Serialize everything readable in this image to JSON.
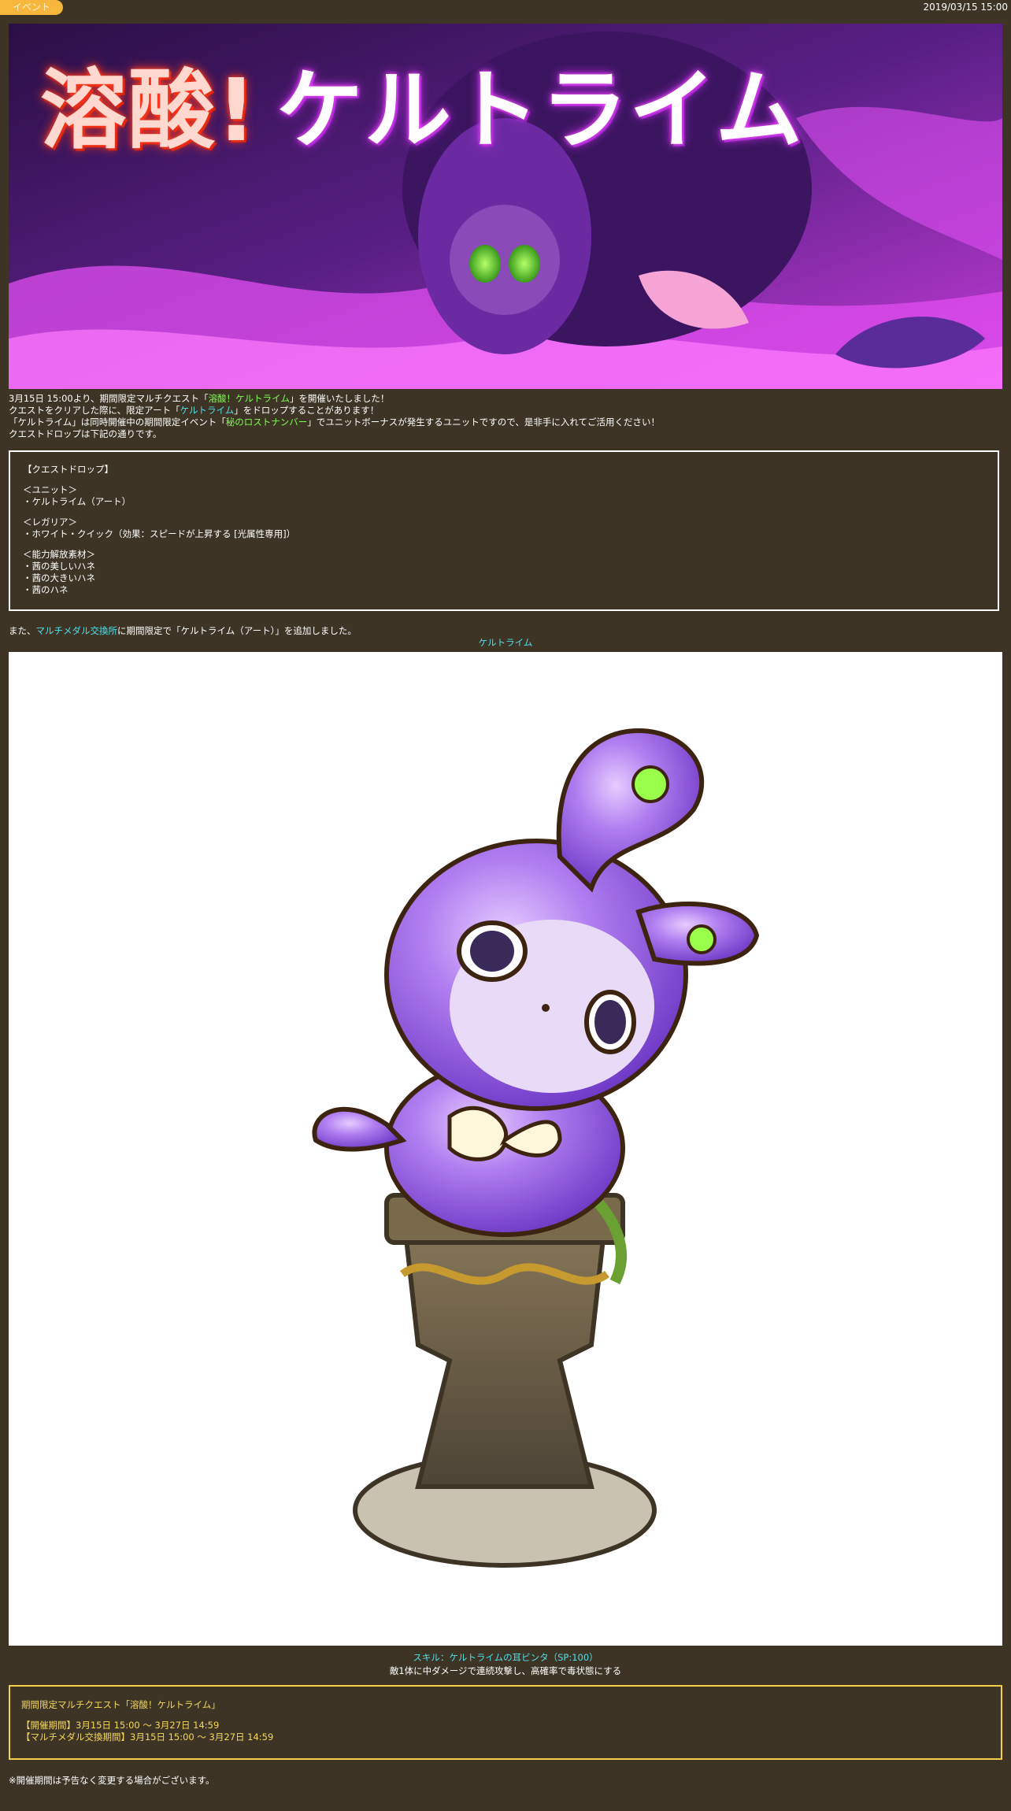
{
  "header": {
    "category_tag": "イベント",
    "date": "2019/03/15 15:00"
  },
  "banner": {
    "title_part1": "溶酸!",
    "title_part2": "ケルトライム"
  },
  "intro": {
    "line1_pre": "3月15日 15:00より、期間限定マルチクエスト「",
    "line1_link": "溶酸！ケルトライム",
    "line1_post": "」を開催いたしました！",
    "line2_pre": "クエストをクリアした際に、限定アート「",
    "line2_link": "ケルトライム",
    "line2_post": "」をドロップすることがあります！",
    "line3_pre": "「ケルトライム」は同時開催中の期間限定イベント「",
    "line3_link": "秘のロストナンバー",
    "line3_post": "」でユニットボーナスが発生するユニットですので、是非手に入れてご活用ください！",
    "line4": "クエストドロップは下記の通りです。"
  },
  "drops": {
    "heading": "【クエストドロップ】",
    "unit_label": "＜ユニット＞",
    "unit_item": "・ケルトライム（アート）",
    "regalia_label": "＜レガリア＞",
    "regalia_item": "・ホワイト・クイック（効果：スピードが上昇する [光属性専用]）",
    "material_label": "＜能力解放素材＞",
    "material_items": [
      "・茜の美しいハネ",
      "・茜の大きいハネ",
      "・茜のハネ"
    ]
  },
  "exchange": {
    "pre": "また、",
    "link": "マルチメダル交換所",
    "post": "に期間限定で「ケルトライム（アート）」を追加しました。"
  },
  "art": {
    "caption": "ケルトライム"
  },
  "skill": {
    "name": "スキル：ケルトライムの耳ビンタ（SP:100）",
    "description": "敵1体に中ダメージで連続攻撃し、高確率で毒状態にする"
  },
  "period": {
    "title": "期間限定マルチクエスト「溶酸！ケルトライム」",
    "event_period": "【開催期間】3月15日 15:00 ～ 3月27日 14:59",
    "exchange_period": "【マルチメダル交換期間】3月15日 15:00 ～ 3月27日 14:59"
  },
  "footer": {
    "note": "※開催期間は予告なく変更する場合がございます。"
  },
  "colors": {
    "background": "#3d3426",
    "tag": "#f6b73c",
    "link_green": "#7dff4f",
    "link_cyan": "#4fe0e8",
    "period_border": "#f2d04a"
  }
}
